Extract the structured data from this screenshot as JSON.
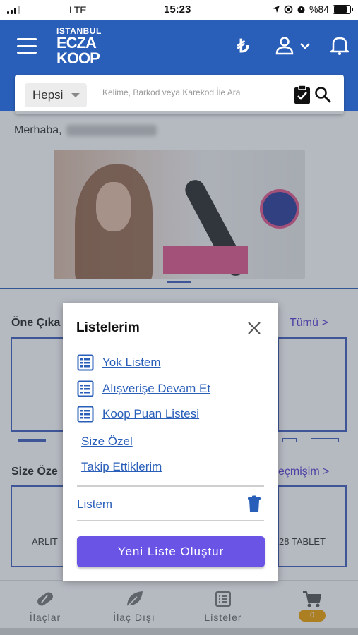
{
  "status_bar": {
    "carrier": "LTE",
    "time": "15:23",
    "battery": "%84",
    "battery_level": 0.84
  },
  "header": {
    "logo": {
      "line1": "ISTANBUL",
      "line2": "ECZA",
      "line3": "KOOP"
    },
    "currency_icon": "₺"
  },
  "search": {
    "category": "Hepsi",
    "placeholder": "Kelime, Barkod veya Karekod İle Ara"
  },
  "home": {
    "greeting": "Merhaba,",
    "featured_title": "Öne Çıka",
    "featured_link": "Tümü >",
    "special_title": "Size Öze",
    "special_link": "eçmişim >",
    "product_left": "ARLIT",
    "product_right": "28 TABLET"
  },
  "bottom_nav": {
    "items": [
      {
        "label": "İlaçlar",
        "icon": "pill-icon"
      },
      {
        "label": "İlaç Dışı",
        "icon": "leaf-icon"
      },
      {
        "label": "Listeler",
        "icon": "list-icon"
      },
      {
        "label": "",
        "icon": "cart-icon"
      }
    ],
    "cart_count": "0"
  },
  "modal": {
    "title": "Listelerim",
    "icon_lists": [
      {
        "label": "Yok Listem"
      },
      {
        "label": "Alışverişe Devam Et"
      },
      {
        "label": "Koop Puan Listesi"
      }
    ],
    "plain_links": [
      {
        "label": "Size Özel"
      },
      {
        "label": "Takip Ettiklerim"
      }
    ],
    "user_list": "Listem",
    "create_button": "Yeni Liste Oluştur"
  },
  "colors": {
    "header_blue": "#2a5fb9",
    "link_blue": "#2a5fb9",
    "button_purple": "#6a54e6",
    "badge_orange": "#f0a200"
  }
}
